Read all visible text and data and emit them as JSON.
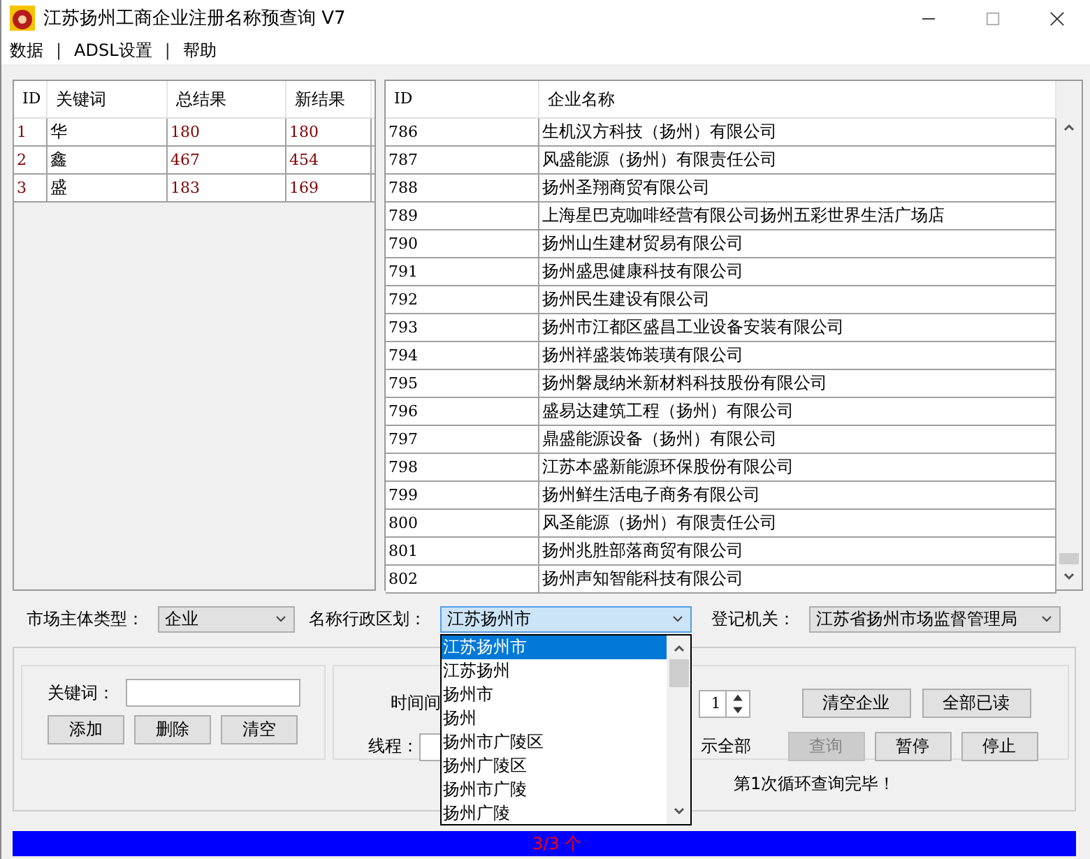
{
  "window": {
    "title": "江苏扬州工商企业注册名称预查询 V7"
  },
  "menu": [
    {
      "label": "数据",
      "kind": "item"
    },
    {
      "label": "|",
      "kind": "separator"
    },
    {
      "label": "ADSL设置",
      "kind": "item"
    },
    {
      "label": "|",
      "kind": "separator"
    },
    {
      "label": "帮助",
      "kind": "item"
    }
  ],
  "keyword_table": {
    "columns": [
      "ID",
      "关键词",
      "总结果",
      "新结果"
    ],
    "rows": [
      {
        "id": "1",
        "keyword": "华",
        "total": "180",
        "new": "180"
      },
      {
        "id": "2",
        "keyword": "鑫",
        "total": "467",
        "new": "454"
      },
      {
        "id": "3",
        "keyword": "盛",
        "total": "183",
        "new": "169"
      }
    ]
  },
  "results_table": {
    "columns": [
      "ID",
      "企业名称"
    ],
    "rows": [
      {
        "id": "786",
        "name": "生机汉方科技（扬州）有限公司"
      },
      {
        "id": "787",
        "name": "风盛能源（扬州）有限责任公司"
      },
      {
        "id": "788",
        "name": "扬州圣翔商贸有限公司"
      },
      {
        "id": "789",
        "name": "上海星巴克咖啡经营有限公司扬州五彩世界生活广场店"
      },
      {
        "id": "790",
        "name": "扬州山生建材贸易有限公司"
      },
      {
        "id": "791",
        "name": "扬州盛思健康科技有限公司"
      },
      {
        "id": "792",
        "name": "扬州民生建设有限公司"
      },
      {
        "id": "793",
        "name": "扬州市江都区盛昌工业设备安装有限公司"
      },
      {
        "id": "794",
        "name": "扬州祥盛装饰装璜有限公司"
      },
      {
        "id": "795",
        "name": "扬州磐晟纳米新材料科技股份有限公司"
      },
      {
        "id": "796",
        "name": "盛易达建筑工程（扬州）有限公司"
      },
      {
        "id": "797",
        "name": "鼎盛能源设备（扬州）有限公司"
      },
      {
        "id": "798",
        "name": "江苏本盛新能源环保股份有限公司"
      },
      {
        "id": "799",
        "name": "扬州鲜生活电子商务有限公司"
      },
      {
        "id": "800",
        "name": "风圣能源（扬州）有限责任公司"
      },
      {
        "id": "801",
        "name": "扬州兆胜部落商贸有限公司"
      },
      {
        "id": "802",
        "name": "扬州声知智能科技有限公司"
      }
    ]
  },
  "filters": {
    "market_type": {
      "label": "市场主体类型：",
      "value": "企业"
    },
    "region": {
      "label": "名称行政区划：",
      "value": "江苏扬州市",
      "expanded": true,
      "options": [
        {
          "label": "江苏扬州市",
          "selected": true
        },
        {
          "label": "江苏扬州",
          "selected": false
        },
        {
          "label": "扬州市",
          "selected": false
        },
        {
          "label": "扬州",
          "selected": false
        },
        {
          "label": "扬州市广陵区",
          "selected": false
        },
        {
          "label": "扬州广陵区",
          "selected": false
        },
        {
          "label": "扬州市广陵",
          "selected": false
        },
        {
          "label": "扬州广陵",
          "selected": false
        }
      ]
    },
    "authority": {
      "label": "登记机关：",
      "value": "江苏省扬州市场监督管理局"
    }
  },
  "keyword_panel": {
    "label": "关键词：",
    "buttons": [
      "添加",
      "删除",
      "清空"
    ]
  },
  "query_panel": {
    "interval_label": "时间间",
    "interval_value": "1",
    "threads_label": "线程：",
    "show_all_label": "示全部",
    "buttons": [
      {
        "label": "清空企业",
        "disabled": false
      },
      {
        "label": "全部已读",
        "disabled": false
      },
      {
        "label": "查询",
        "disabled": true
      },
      {
        "label": "暂停",
        "disabled": false
      },
      {
        "label": "停止",
        "disabled": false
      }
    ],
    "message": "第1次循环查询完毕！"
  },
  "progress": {
    "text": "3/3 个",
    "level": 1
  }
}
